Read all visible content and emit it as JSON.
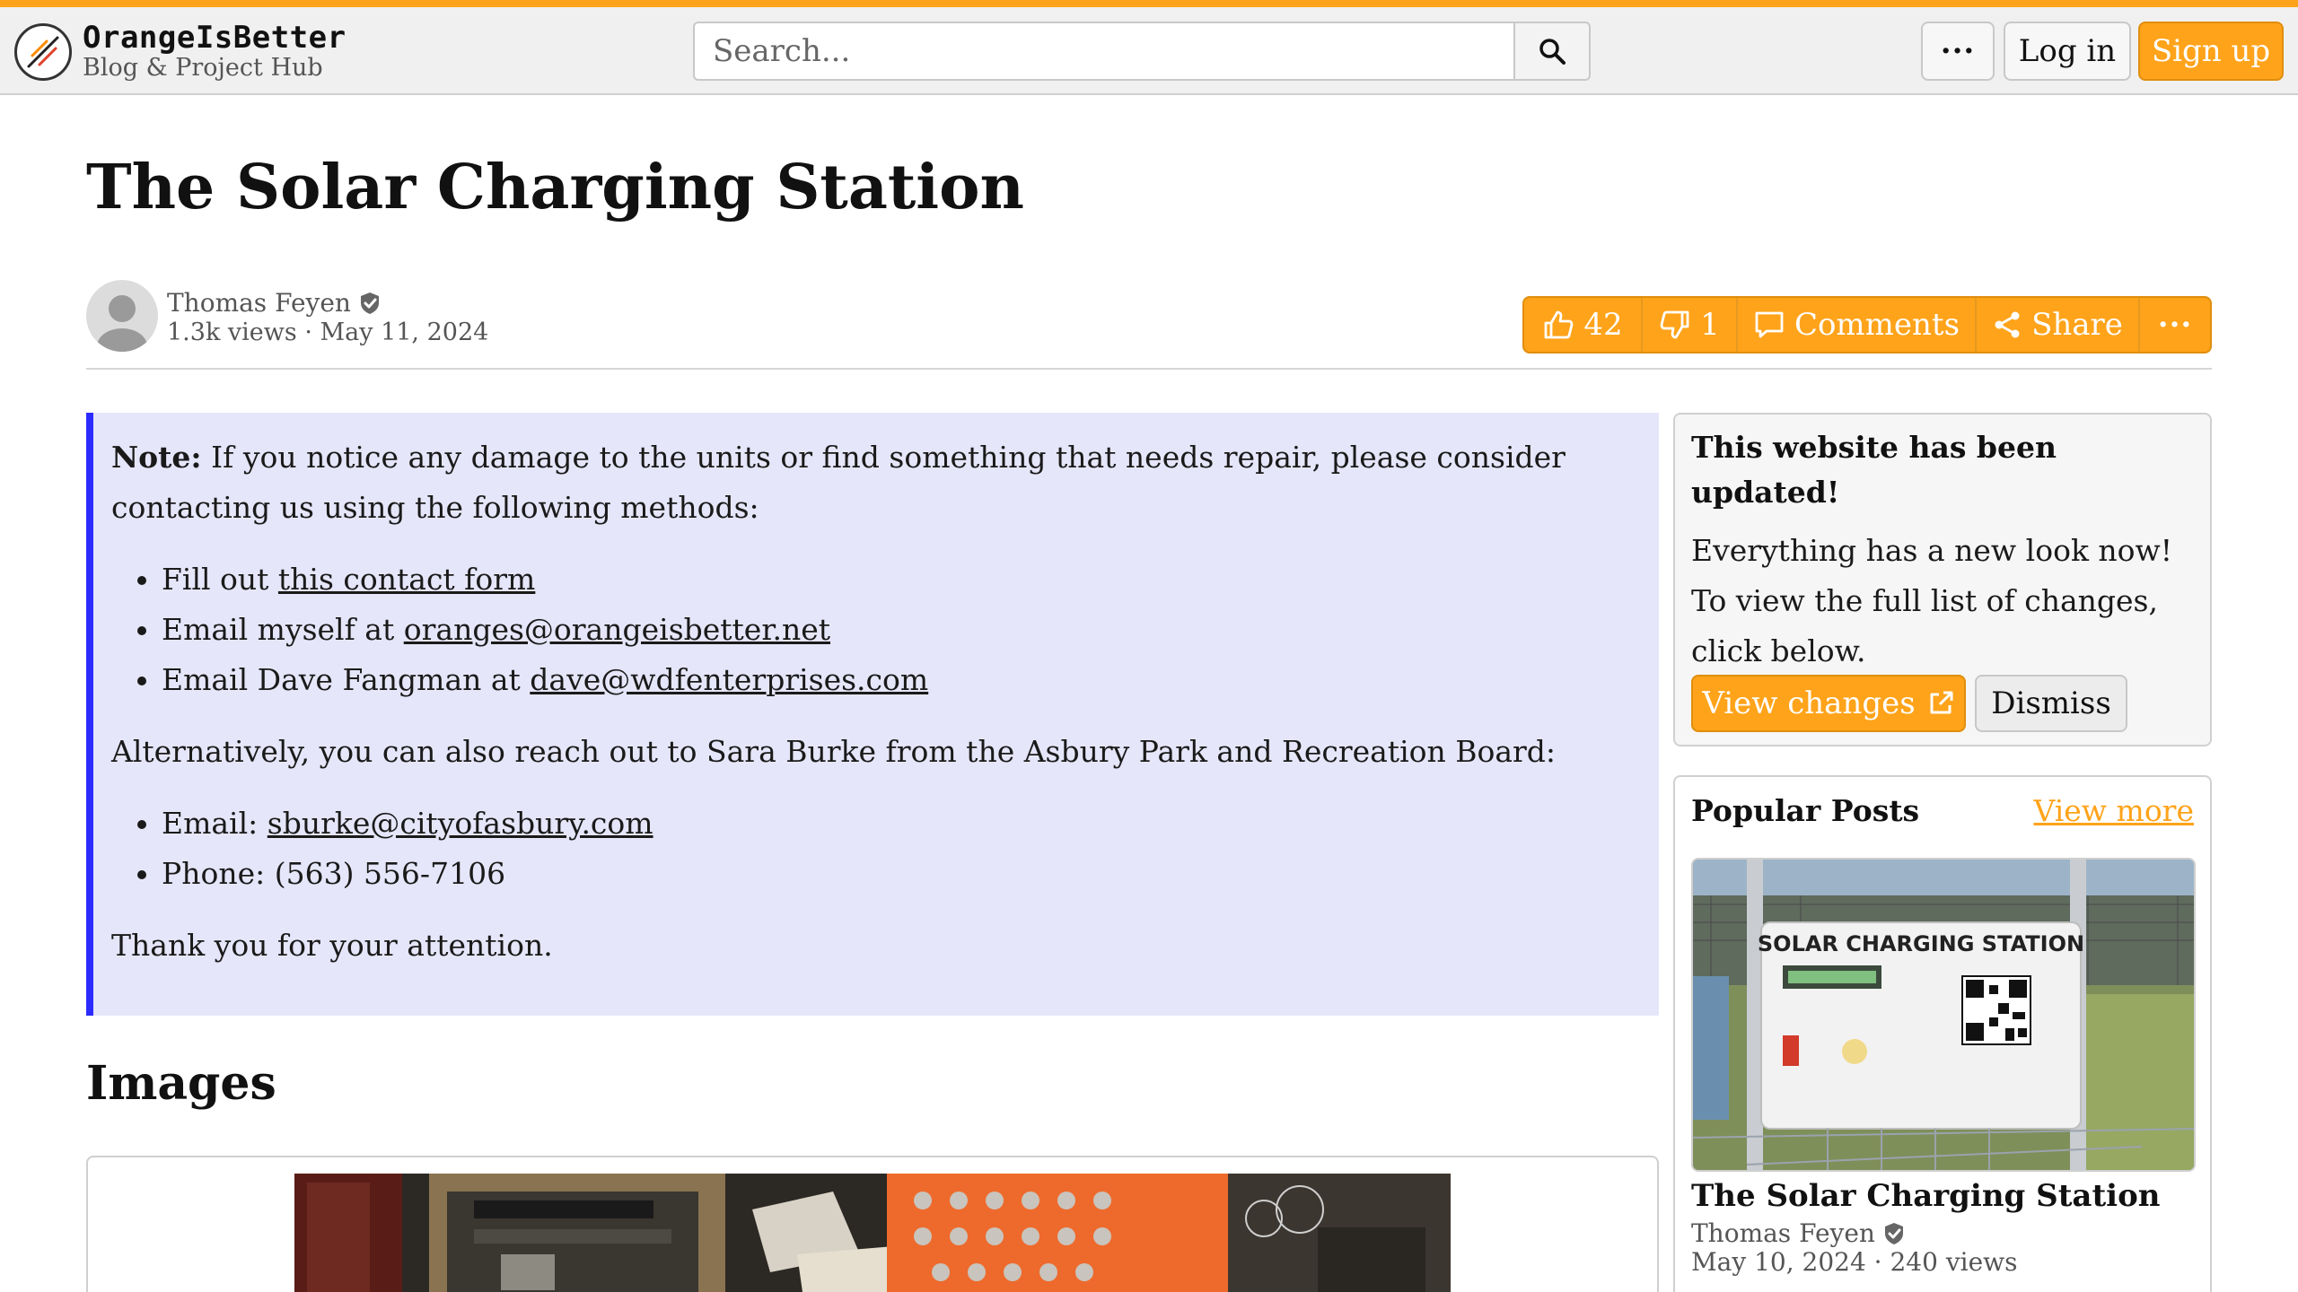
{
  "header": {
    "brand_name": "OrangeIsBetter",
    "brand_sub": "Blog & Project Hub",
    "search_placeholder": "Search...",
    "more_label": "···",
    "login_label": "Log in",
    "signup_label": "Sign up"
  },
  "article": {
    "title": "The Solar Charging Station",
    "author": "Thomas Feyen",
    "views": "1.3k views",
    "date": "May 11, 2024"
  },
  "actions": {
    "likes": "42",
    "dislikes": "1",
    "comments_label": "Comments",
    "share_label": "Share",
    "more_label": "···"
  },
  "note": {
    "lead_bold": "Note:",
    "lead_text": "If you notice any damage to the units or find something that needs repair, please consider contacting us using the following methods:",
    "item1_prefix": "Fill out ",
    "item1_link": "this contact form",
    "item2_prefix": "Email myself at ",
    "item2_link": "oranges@orangeisbetter.net",
    "item3_prefix": "Email Dave Fangman at ",
    "item3_link": "dave@wdfenterprises.com",
    "alt_text": "Alternatively, you can also reach out to Sara Burke from the Asbury Park and Recreation Board:",
    "email_prefix": "Email: ",
    "email_link": "sburke@cityofasbury.com",
    "phone": "Phone: (563) 556-7106",
    "thanks": "Thank you for your attention."
  },
  "images_heading": "Images",
  "update_card": {
    "title": "This website has been updated!",
    "body": "Everything has a new look now! To view the full list of changes, click below.",
    "view_label": "View changes",
    "dismiss_label": "Dismiss"
  },
  "popular": {
    "title": "Popular Posts",
    "view_more": "View more",
    "post_sign_text": "SOLAR CHARGING STATION",
    "post_title": "The Solar Charging Station",
    "post_author": "Thomas Feyen",
    "post_meta": "May 10, 2024 · 240 views"
  },
  "colors": {
    "accent": "#ffa31a",
    "note_bg": "#e6e6fa",
    "note_border": "#2b2bff"
  }
}
